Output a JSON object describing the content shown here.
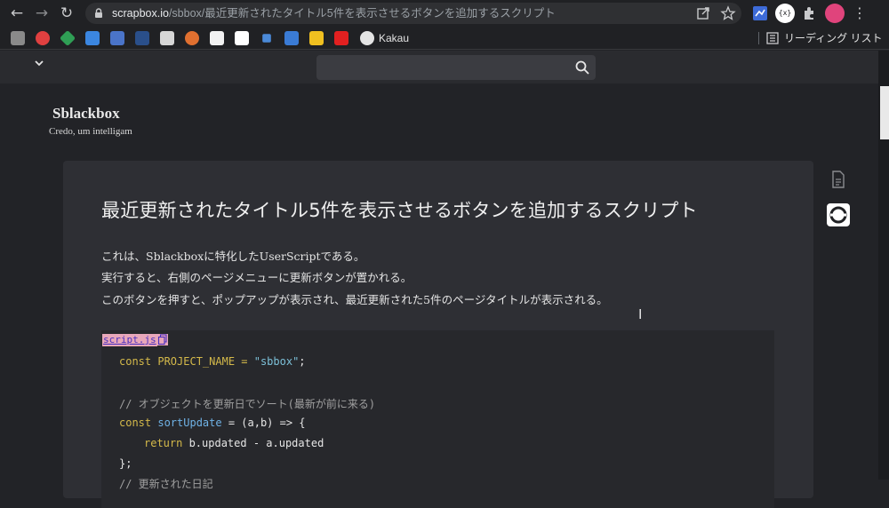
{
  "browser": {
    "back": "←",
    "forward": "→",
    "reload": "↻",
    "url_host": "scrapbox.io",
    "url_path": "/sbbox/最近更新されたタイトル5件を表示させるボタンを追加するスクリプト",
    "bookmarks": {
      "kakau": "Kakau",
      "reading_list": "リーディング リスト"
    },
    "extension_badge": "{x}"
  },
  "app_header": {
    "search_value": "",
    "menu_caret": "⌄"
  },
  "project": {
    "title": "Sblackbox",
    "subtitle": "Credo, um intelligam"
  },
  "page": {
    "title": "最近更新されたタイトル5件を表示させるボタンを追加するスクリプト",
    "paragraphs": [
      "これは、Sblackboxに特化したUserScriptである。",
      "実行すると、右側のページメニューに更新ボタンが置かれる。",
      "このボタンを押すと、ポップアップが表示され、最近更新された5件のページタイトルが表示される。"
    ],
    "code": {
      "filename": "script.js",
      "line1_kw": "const",
      "line1_name": " PROJECT_NAME = ",
      "line1_str": "\"sbbox\"",
      "line1_end": ";",
      "comment1": "// オブジェクトを更新日でソート(最新が前に来る)",
      "line3_kw": "const",
      "line3_fn": "sortUpdate",
      "line3_rest": " = (a,b) => {",
      "line4_kw": "return",
      "line4_rest": " b.updated - a.updated",
      "line5": "};",
      "line6": "// 更新された日記"
    }
  },
  "colors": {
    "background": "#222327",
    "card": "#2e2f34",
    "code_bg": "#27282c",
    "keyword": "#d4b94a",
    "string": "#7cc0d8",
    "label_bg": "#e8a7ba"
  }
}
